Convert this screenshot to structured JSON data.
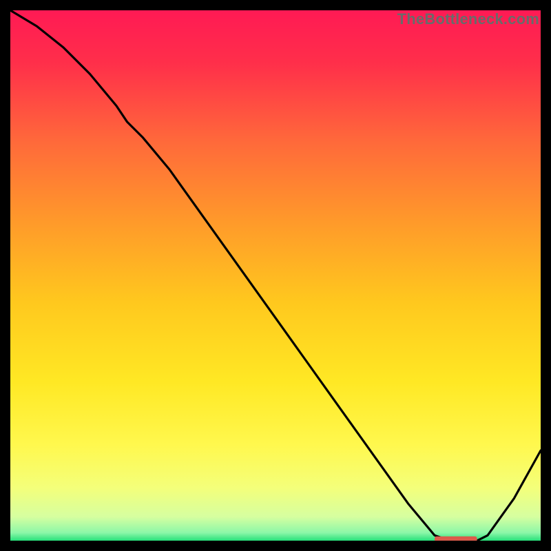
{
  "watermark": "TheBottleneck.com",
  "chart_data": {
    "type": "line",
    "title": "",
    "xlabel": "",
    "ylabel": "",
    "xlim": [
      0,
      100
    ],
    "ylim": [
      0,
      100
    ],
    "grid": false,
    "legend": false,
    "series": [
      {
        "name": "curve",
        "color": "#000000",
        "x": [
          0,
          5,
          10,
          15,
          20,
          22,
          25,
          30,
          35,
          40,
          45,
          50,
          55,
          60,
          65,
          70,
          75,
          80,
          82,
          84,
          86,
          88,
          90,
          95,
          100
        ],
        "y": [
          100,
          97,
          93,
          88,
          82,
          79,
          76,
          70,
          63,
          56,
          49,
          42,
          35,
          28,
          21,
          14,
          7,
          1,
          0.3,
          0,
          0,
          0,
          1,
          8,
          17
        ]
      }
    ],
    "marker": {
      "name": "optimal-range",
      "color": "#db5a4b",
      "x_start": 80,
      "x_end": 88,
      "y": 0.3
    },
    "gradient_stops": [
      {
        "offset": 0.0,
        "color": "#ff1a54"
      },
      {
        "offset": 0.1,
        "color": "#ff2f4a"
      },
      {
        "offset": 0.25,
        "color": "#ff6a3a"
      },
      {
        "offset": 0.4,
        "color": "#ff9a2a"
      },
      {
        "offset": 0.55,
        "color": "#ffc81e"
      },
      {
        "offset": 0.7,
        "color": "#ffe824"
      },
      {
        "offset": 0.82,
        "color": "#fff84e"
      },
      {
        "offset": 0.9,
        "color": "#f4ff7a"
      },
      {
        "offset": 0.955,
        "color": "#d6ffa0"
      },
      {
        "offset": 0.985,
        "color": "#8cf7a8"
      },
      {
        "offset": 1.0,
        "color": "#27e07a"
      }
    ]
  }
}
